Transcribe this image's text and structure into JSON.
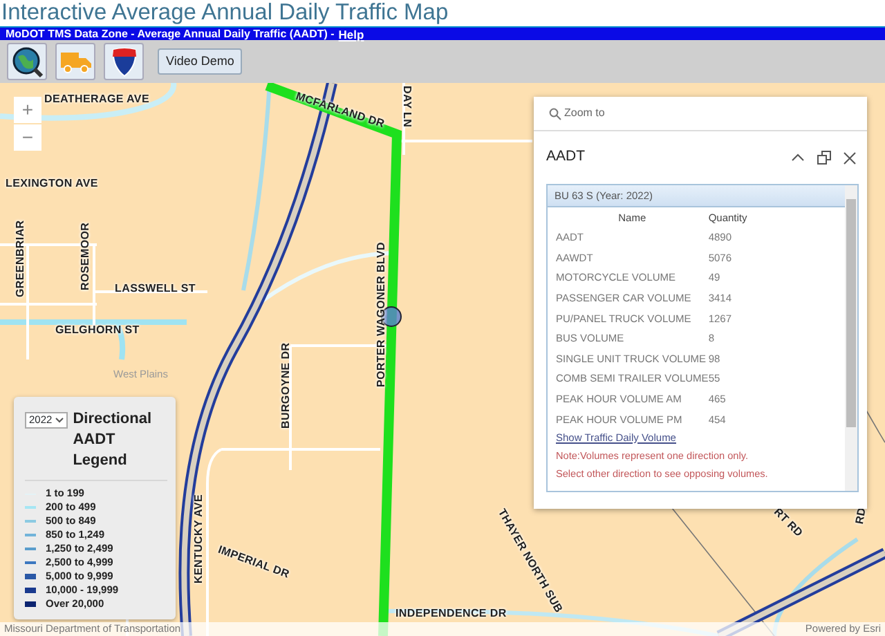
{
  "page_title": "Interactive Average Annual Daily Traffic Map",
  "banner": {
    "text": "MoDOT TMS Data Zone - Average Annual Daily Traffic (AADT) - ",
    "link": "Help"
  },
  "toolbar": {
    "buttons": [
      "Video Demo"
    ]
  },
  "map": {
    "zoom_in": "+",
    "zoom_out": "−",
    "streets": [
      {
        "label": "DEATHERAGE AVE"
      },
      {
        "label": "MCFARLAND DR"
      },
      {
        "label": "DAY LN"
      },
      {
        "label": "LEXINGTON AVE"
      },
      {
        "label": "GREENBRIAR"
      },
      {
        "label": "ROSEMOOR"
      },
      {
        "label": "LASSWELL ST"
      },
      {
        "label": "GELGHORN ST"
      },
      {
        "label": "PORTER WAGONER BLVD"
      },
      {
        "label": "BURGOYNE DR"
      },
      {
        "label": "KENTUCKY AVE"
      },
      {
        "label": "IMPERIAL DR"
      },
      {
        "label": "INDEPENDENCE DR"
      },
      {
        "label": "THAYER NORTH SUB"
      },
      {
        "label": "RT RD"
      },
      {
        "label": "RD"
      }
    ],
    "places": [
      "West Plains"
    ]
  },
  "popup": {
    "zoom_to": "Zoom to",
    "title": "AADT",
    "feature_header": "BU 63 S (Year: 2022)",
    "columns": [
      "Name",
      "Quantity"
    ],
    "rows": [
      {
        "name": "AADT",
        "quantity": "4890"
      },
      {
        "name": "AAWDT",
        "quantity": "5076"
      },
      {
        "name": "MOTORCYCLE VOLUME",
        "quantity": "49"
      },
      {
        "name": "PASSENGER CAR VOLUME",
        "quantity": "3414"
      },
      {
        "name": "PU/PANEL TRUCK VOLUME",
        "quantity": "1267"
      },
      {
        "name": "BUS VOLUME",
        "quantity": "8"
      },
      {
        "name": "SINGLE UNIT TRUCK VOLUME",
        "quantity": "98"
      },
      {
        "name": "COMB SEMI TRAILER VOLUME",
        "quantity": "55"
      },
      {
        "name": "PEAK HOUR VOLUME AM",
        "quantity": "465"
      },
      {
        "name": "PEAK HOUR VOLUME PM",
        "quantity": "454"
      }
    ],
    "link": "Show Traffic Daily Volume",
    "notes": [
      "Note:Volumes represent one direction only.",
      "Select other direction to see opposing volumes."
    ]
  },
  "legend": {
    "year": "2022",
    "title": "Directional AADT Legend",
    "items": [
      {
        "label": "1 to 199",
        "color": "#e4f2f6"
      },
      {
        "label": "200 to 499",
        "color": "#a6e6f4"
      },
      {
        "label": "500 to 849",
        "color": "#8ccbe2"
      },
      {
        "label": "850 to 1,249",
        "color": "#72b4da"
      },
      {
        "label": "1,250 to 2,499",
        "color": "#5a9dcc"
      },
      {
        "label": "2,500 to 4,999",
        "color": "#3c78c0"
      },
      {
        "label": "5,000 to 9,999",
        "color": "#2a58a6"
      },
      {
        "label": "10,000 - 19,999",
        "color": "#1a3a8e"
      },
      {
        "label": "Over 20,000",
        "color": "#0c2470"
      }
    ]
  },
  "attribution": {
    "left": "Missouri Department of Transportation",
    "right": "Powered by Esri"
  }
}
